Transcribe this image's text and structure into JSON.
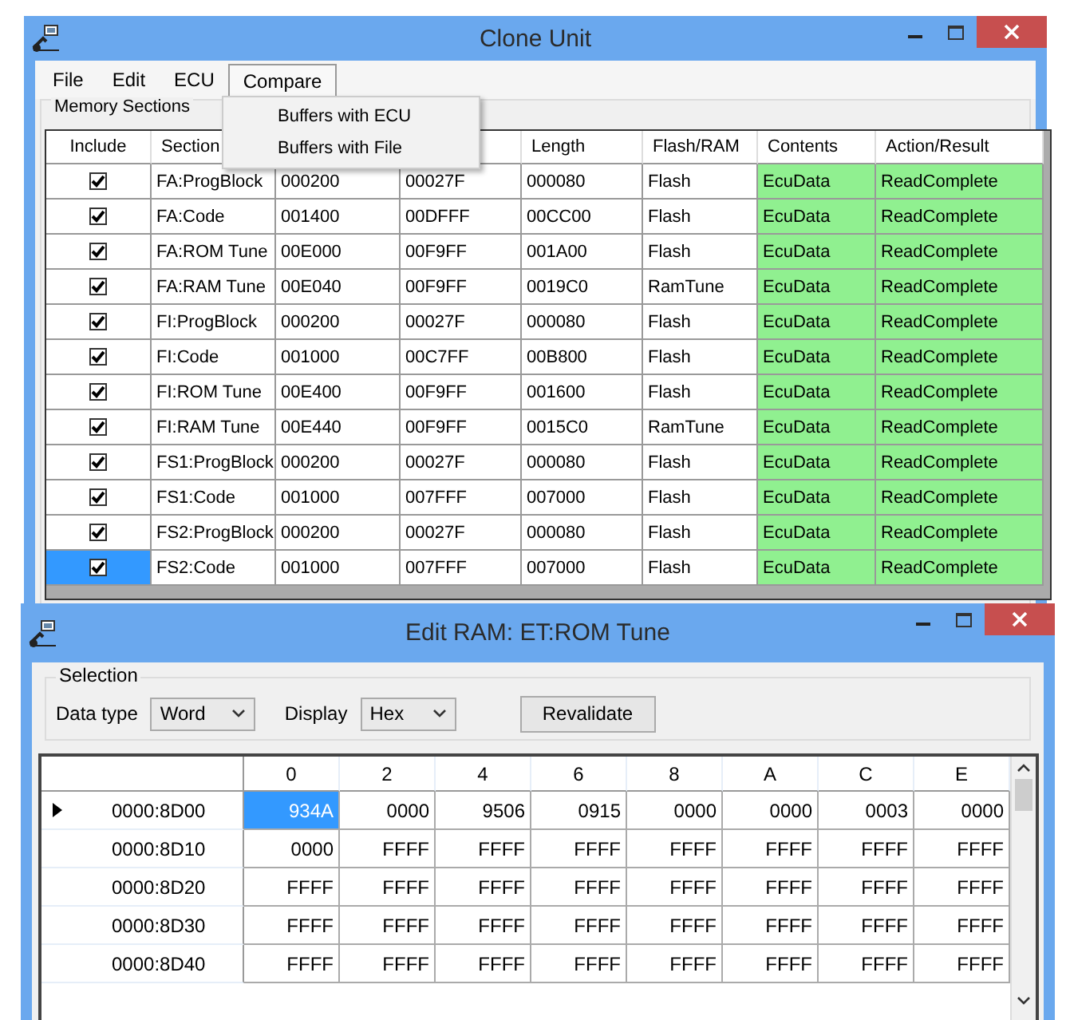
{
  "clone_window": {
    "title": "Clone Unit",
    "menu": [
      {
        "label": "File",
        "selected": false
      },
      {
        "label": "Edit",
        "selected": false
      },
      {
        "label": "ECU",
        "selected": false
      },
      {
        "label": "Compare",
        "selected": true
      }
    ],
    "open_menu": {
      "items": [
        "Buffers with ECU",
        "Buffers with File"
      ]
    },
    "group_title": "Memory Sections",
    "table": {
      "columns": [
        {
          "label": "Include"
        },
        {
          "label": "Section"
        },
        {},
        {},
        {
          "label": "Length"
        },
        {
          "label": "Flash/RAM"
        },
        {
          "label": "Contents"
        },
        {
          "label": "Action/Result"
        }
      ],
      "rows": [
        {
          "include": true,
          "selected": false,
          "section": "FA:ProgBlock",
          "column_3": "000200",
          "column_4": "00027F",
          "length": "000080",
          "memory": "Flash",
          "contents": "EcuData",
          "result": "ReadComplete"
        },
        {
          "include": true,
          "selected": false,
          "section": "FA:Code",
          "column_3": "001400",
          "column_4": "00DFFF",
          "length": "00CC00",
          "memory": "Flash",
          "contents": "EcuData",
          "result": "ReadComplete"
        },
        {
          "include": true,
          "selected": false,
          "section": "FA:ROM Tune",
          "column_3": "00E000",
          "column_4": "00F9FF",
          "length": "001A00",
          "memory": "Flash",
          "contents": "EcuData",
          "result": "ReadComplete"
        },
        {
          "include": true,
          "selected": false,
          "section": "FA:RAM Tune",
          "column_3": "00E040",
          "column_4": "00F9FF",
          "length": "0019C0",
          "memory": "RamTune",
          "contents": "EcuData",
          "result": "ReadComplete"
        },
        {
          "include": true,
          "selected": false,
          "section": "FI:ProgBlock",
          "column_3": "000200",
          "column_4": "00027F",
          "length": "000080",
          "memory": "Flash",
          "contents": "EcuData",
          "result": "ReadComplete"
        },
        {
          "include": true,
          "selected": false,
          "section": "FI:Code",
          "column_3": "001000",
          "column_4": "00C7FF",
          "length": "00B800",
          "memory": "Flash",
          "contents": "EcuData",
          "result": "ReadComplete"
        },
        {
          "include": true,
          "selected": false,
          "section": "FI:ROM Tune",
          "column_3": "00E400",
          "column_4": "00F9FF",
          "length": "001600",
          "memory": "Flash",
          "contents": "EcuData",
          "result": "ReadComplete"
        },
        {
          "include": true,
          "selected": false,
          "section": "FI:RAM Tune",
          "column_3": "00E440",
          "column_4": "00F9FF",
          "length": "0015C0",
          "memory": "RamTune",
          "contents": "EcuData",
          "result": "ReadComplete"
        },
        {
          "include": true,
          "selected": false,
          "section": "FS1:ProgBlock",
          "column_3": "000200",
          "column_4": "00027F",
          "length": "000080",
          "memory": "Flash",
          "contents": "EcuData",
          "result": "ReadComplete"
        },
        {
          "include": true,
          "selected": false,
          "section": "FS1:Code",
          "column_3": "001000",
          "column_4": "007FFF",
          "length": "007000",
          "memory": "Flash",
          "contents": "EcuData",
          "result": "ReadComplete"
        },
        {
          "include": true,
          "selected": false,
          "section": "FS2:ProgBlock",
          "column_3": "000200",
          "column_4": "00027F",
          "length": "000080",
          "memory": "Flash",
          "contents": "EcuData",
          "result": "ReadComplete"
        },
        {
          "include": true,
          "selected": true,
          "section": "FS2:Code",
          "column_3": "001000",
          "column_4": "007FFF",
          "length": "007000",
          "memory": "Flash",
          "contents": "EcuData",
          "result": "ReadComplete"
        }
      ]
    }
  },
  "ram_window": {
    "title": "Edit RAM: ET:ROM Tune",
    "group_title": "Selection",
    "data_type": {
      "label": "Data type",
      "value": "Word"
    },
    "display": {
      "label": "Display",
      "value": "Hex"
    },
    "button": "Revalidate",
    "grid": {
      "columns": [
        "0",
        "2",
        "4",
        "6",
        "8",
        "A",
        "C",
        "E"
      ],
      "rows": [
        {
          "address": "0000:8D00",
          "current": true,
          "cells": [
            {
              "value": "934A",
              "selected": true
            },
            {
              "value": "0000",
              "selected": false
            },
            {
              "value": "9506",
              "selected": false
            },
            {
              "value": "0915",
              "selected": false
            },
            {
              "value": "0000",
              "selected": false
            },
            {
              "value": "0000",
              "selected": false
            },
            {
              "value": "0003",
              "selected": false
            },
            {
              "value": "0000",
              "selected": false
            }
          ]
        },
        {
          "address": "0000:8D10",
          "current": false,
          "cells": [
            {
              "value": "0000",
              "selected": false
            },
            {
              "value": "FFFF",
              "selected": false
            },
            {
              "value": "FFFF",
              "selected": false
            },
            {
              "value": "FFFF",
              "selected": false
            },
            {
              "value": "FFFF",
              "selected": false
            },
            {
              "value": "FFFF",
              "selected": false
            },
            {
              "value": "FFFF",
              "selected": false
            },
            {
              "value": "FFFF",
              "selected": false
            }
          ]
        },
        {
          "address": "0000:8D20",
          "current": false,
          "cells": [
            {
              "value": "FFFF",
              "selected": false
            },
            {
              "value": "FFFF",
              "selected": false
            },
            {
              "value": "FFFF",
              "selected": false
            },
            {
              "value": "FFFF",
              "selected": false
            },
            {
              "value": "FFFF",
              "selected": false
            },
            {
              "value": "FFFF",
              "selected": false
            },
            {
              "value": "FFFF",
              "selected": false
            },
            {
              "value": "FFFF",
              "selected": false
            }
          ]
        },
        {
          "address": "0000:8D30",
          "current": false,
          "cells": [
            {
              "value": "FFFF",
              "selected": false
            },
            {
              "value": "FFFF",
              "selected": false
            },
            {
              "value": "FFFF",
              "selected": false
            },
            {
              "value": "FFFF",
              "selected": false
            },
            {
              "value": "FFFF",
              "selected": false
            },
            {
              "value": "FFFF",
              "selected": false
            },
            {
              "value": "FFFF",
              "selected": false
            },
            {
              "value": "FFFF",
              "selected": false
            }
          ]
        },
        {
          "address": "0000:8D40",
          "current": false,
          "cells": [
            {
              "value": "FFFF",
              "selected": false
            },
            {
              "value": "FFFF",
              "selected": false
            },
            {
              "value": "FFFF",
              "selected": false
            },
            {
              "value": "FFFF",
              "selected": false
            },
            {
              "value": "FFFF",
              "selected": false
            },
            {
              "value": "FFFF",
              "selected": false
            },
            {
              "value": "FFFF",
              "selected": false
            },
            {
              "value": "FFFF",
              "selected": false
            }
          ]
        }
      ]
    }
  }
}
